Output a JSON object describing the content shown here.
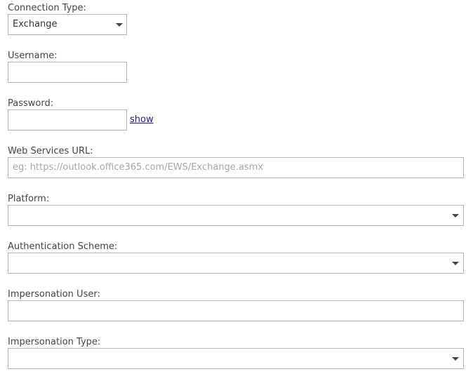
{
  "connection_type": {
    "label": "Connection Type:",
    "value": "Exchange"
  },
  "username": {
    "label": "Username:",
    "value": ""
  },
  "password": {
    "label": "Password:",
    "value": "",
    "show_link": "show"
  },
  "web_services_url": {
    "label": "Web Services URL:",
    "placeholder": "eg: https://outlook.office365.com/EWS/Exchange.asmx",
    "value": ""
  },
  "platform": {
    "label": "Platform:",
    "value": ""
  },
  "authentication_scheme": {
    "label": "Authentication Scheme:",
    "value": ""
  },
  "impersonation_user": {
    "label": "Impersonation User:",
    "value": ""
  },
  "impersonation_type": {
    "label": "Impersonation Type:",
    "value": ""
  },
  "icons": {
    "dropdown": "chevron-down-icon"
  }
}
